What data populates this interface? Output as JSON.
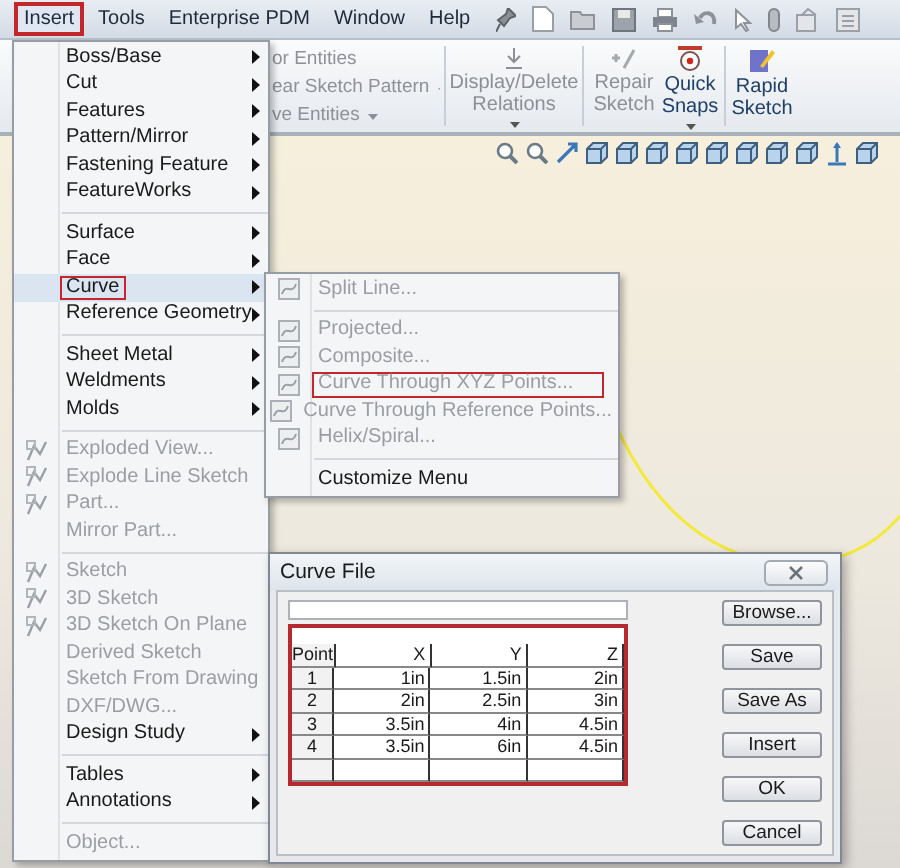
{
  "menubar": [
    {
      "label": "Insert",
      "selected": true
    },
    {
      "label": "Tools",
      "selected": false
    },
    {
      "label": "Enterprise PDM",
      "selected": false
    },
    {
      "label": "Window",
      "selected": false
    },
    {
      "label": "Help",
      "selected": false
    }
  ],
  "ribbon": {
    "partial_items": [
      {
        "label": "or Entities",
        "dropdown": false
      },
      {
        "label": "ear Sketch Pattern",
        "dropdown": true
      },
      {
        "label": "ve Entities",
        "dropdown": true
      }
    ],
    "buttons": [
      {
        "label": "Display/Delete Relations",
        "dropdown": true
      },
      {
        "label": "Repair Sketch",
        "dropdown": false
      },
      {
        "label": "Quick Snaps",
        "dropdown": true
      },
      {
        "label": "Rapid Sketch",
        "dropdown": false
      }
    ]
  },
  "insert_menu": [
    {
      "kind": "item",
      "label": "Boss/Base",
      "disabled": false,
      "submenu": true,
      "selected": false,
      "has_icon": false
    },
    {
      "kind": "item",
      "label": "Cut",
      "disabled": false,
      "submenu": true,
      "selected": false,
      "has_icon": false
    },
    {
      "kind": "item",
      "label": "Features",
      "disabled": false,
      "submenu": true,
      "selected": false,
      "has_icon": false
    },
    {
      "kind": "item",
      "label": "Pattern/Mirror",
      "disabled": false,
      "submenu": true,
      "selected": false,
      "has_icon": false
    },
    {
      "kind": "item",
      "label": "Fastening Feature",
      "disabled": false,
      "submenu": true,
      "selected": false,
      "has_icon": false
    },
    {
      "kind": "item",
      "label": "FeatureWorks",
      "disabled": false,
      "submenu": true,
      "selected": false,
      "has_icon": false
    },
    {
      "kind": "separator"
    },
    {
      "kind": "item",
      "label": "Surface",
      "disabled": false,
      "submenu": true,
      "selected": false,
      "has_icon": false
    },
    {
      "kind": "item",
      "label": "Face",
      "disabled": false,
      "submenu": true,
      "selected": false,
      "has_icon": false
    },
    {
      "kind": "item",
      "label": "Curve",
      "disabled": false,
      "submenu": true,
      "selected": true,
      "has_icon": false
    },
    {
      "kind": "item",
      "label": "Reference Geometry",
      "disabled": false,
      "submenu": true,
      "selected": false,
      "has_icon": false
    },
    {
      "kind": "separator"
    },
    {
      "kind": "item",
      "label": "Sheet Metal",
      "disabled": false,
      "submenu": true,
      "selected": false,
      "has_icon": false
    },
    {
      "kind": "item",
      "label": "Weldments",
      "disabled": false,
      "submenu": true,
      "selected": false,
      "has_icon": false
    },
    {
      "kind": "item",
      "label": "Molds",
      "disabled": false,
      "submenu": true,
      "selected": false,
      "has_icon": false
    },
    {
      "kind": "separator"
    },
    {
      "kind": "item",
      "label": "Exploded View...",
      "disabled": true,
      "submenu": false,
      "selected": false,
      "has_icon": true
    },
    {
      "kind": "item",
      "label": "Explode Line Sketch",
      "disabled": true,
      "submenu": false,
      "selected": false,
      "has_icon": true
    },
    {
      "kind": "item",
      "label": "Part...",
      "disabled": true,
      "submenu": false,
      "selected": false,
      "has_icon": true
    },
    {
      "kind": "item",
      "label": "Mirror Part...",
      "disabled": true,
      "submenu": false,
      "selected": false,
      "has_icon": false
    },
    {
      "kind": "separator"
    },
    {
      "kind": "item",
      "label": "Sketch",
      "disabled": true,
      "submenu": false,
      "selected": false,
      "has_icon": true
    },
    {
      "kind": "item",
      "label": "3D Sketch",
      "disabled": true,
      "submenu": false,
      "selected": false,
      "has_icon": true
    },
    {
      "kind": "item",
      "label": "3D Sketch On Plane",
      "disabled": true,
      "submenu": false,
      "selected": false,
      "has_icon": true
    },
    {
      "kind": "item",
      "label": "Derived Sketch",
      "disabled": true,
      "submenu": false,
      "selected": false,
      "has_icon": false
    },
    {
      "kind": "item",
      "label": "Sketch From Drawing",
      "disabled": true,
      "submenu": false,
      "selected": false,
      "has_icon": false
    },
    {
      "kind": "item",
      "label": "DXF/DWG...",
      "disabled": true,
      "submenu": false,
      "selected": false,
      "has_icon": false
    },
    {
      "kind": "item",
      "label": "Design Study",
      "disabled": false,
      "submenu": true,
      "selected": false,
      "has_icon": false
    },
    {
      "kind": "separator"
    },
    {
      "kind": "item",
      "label": "Tables",
      "disabled": false,
      "submenu": true,
      "selected": false,
      "has_icon": false
    },
    {
      "kind": "item",
      "label": "Annotations",
      "disabled": false,
      "submenu": true,
      "selected": false,
      "has_icon": false
    },
    {
      "kind": "separator"
    },
    {
      "kind": "item",
      "label": "Object...",
      "disabled": true,
      "submenu": false,
      "selected": false,
      "has_icon": false
    }
  ],
  "curve_submenu": [
    {
      "kind": "item",
      "label": "Split Line...",
      "disabled": true,
      "selected": false,
      "has_icon": true
    },
    {
      "kind": "separator"
    },
    {
      "kind": "item",
      "label": "Projected...",
      "disabled": true,
      "selected": false,
      "has_icon": true
    },
    {
      "kind": "item",
      "label": "Composite...",
      "disabled": true,
      "selected": false,
      "has_icon": true
    },
    {
      "kind": "item",
      "label": "Curve Through XYZ Points...",
      "disabled": true,
      "selected": true,
      "has_icon": true
    },
    {
      "kind": "item",
      "label": "Curve Through Reference Points...",
      "disabled": true,
      "selected": false,
      "has_icon": true
    },
    {
      "kind": "item",
      "label": "Helix/Spiral...",
      "disabled": true,
      "selected": false,
      "has_icon": true
    },
    {
      "kind": "separator"
    },
    {
      "kind": "item",
      "label": "Customize Menu",
      "disabled": false,
      "selected": false,
      "has_icon": false
    }
  ],
  "dialog": {
    "title": "Curve File",
    "table": {
      "highlighted": true,
      "columns": [
        "Point",
        "X",
        "Y",
        "Z"
      ],
      "rows": [
        [
          "1",
          "1in",
          "1.5in",
          "2in"
        ],
        [
          "2",
          "2in",
          "2.5in",
          "3in"
        ],
        [
          "3",
          "3.5in",
          "4in",
          "4.5in"
        ],
        [
          "4",
          "3.5in",
          "6in",
          "4.5in"
        ]
      ]
    },
    "buttons": [
      "Browse...",
      "Save",
      "Save As",
      "Insert",
      "OK",
      "Cancel"
    ]
  }
}
